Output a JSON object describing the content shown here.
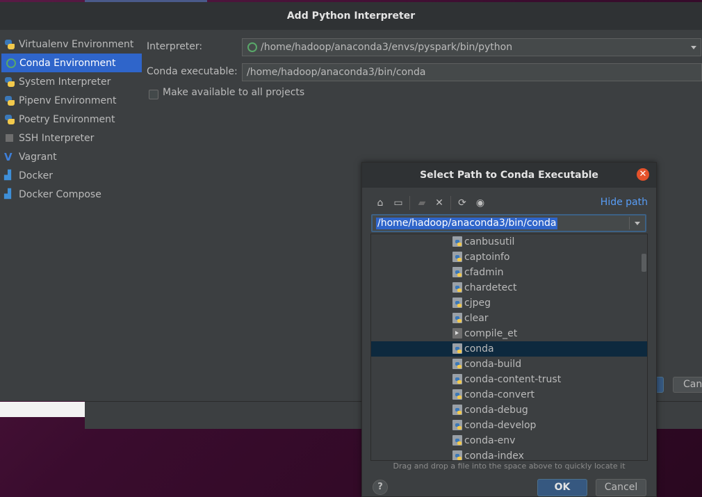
{
  "main_dialog": {
    "title": "Add Python Interpreter",
    "sidebar": [
      {
        "label": "Virtualenv Environment",
        "icon": "python-icon"
      },
      {
        "label": "Conda Environment",
        "icon": "conda-icon",
        "selected": true
      },
      {
        "label": "System Interpreter",
        "icon": "python-icon"
      },
      {
        "label": "Pipenv Environment",
        "icon": "pipenv-icon"
      },
      {
        "label": "Poetry Environment",
        "icon": "poetry-icon"
      },
      {
        "label": "SSH Interpreter",
        "icon": "terminal-icon"
      },
      {
        "label": "Vagrant",
        "icon": "vagrant-icon"
      },
      {
        "label": "Docker",
        "icon": "docker-icon"
      },
      {
        "label": "Docker Compose",
        "icon": "docker-icon"
      }
    ],
    "interpreter_label": "Interpreter:",
    "interpreter_value": "/home/hadoop/anaconda3/envs/pyspark/bin/python",
    "conda_exec_label": "Conda executable:",
    "conda_exec_value": "/home/hadoop/anaconda3/bin/conda",
    "make_available_label": "Make available to all projects",
    "cancel_peek": "Canc"
  },
  "file_chooser": {
    "title": "Select Path to Conda Executable",
    "hide_path": "Hide path",
    "path_value": "/home/hadoop/anaconda3/bin/conda",
    "files": [
      {
        "name": "canbusutil",
        "icon": "python-file-icon"
      },
      {
        "name": "captoinfo",
        "icon": "python-file-icon"
      },
      {
        "name": "cfadmin",
        "icon": "python-file-icon"
      },
      {
        "name": "chardetect",
        "icon": "python-file-icon"
      },
      {
        "name": "cjpeg",
        "icon": "python-file-icon"
      },
      {
        "name": "clear",
        "icon": "python-file-icon"
      },
      {
        "name": "compile_et",
        "icon": "executable-icon"
      },
      {
        "name": "conda",
        "icon": "python-file-icon",
        "selected": true
      },
      {
        "name": "conda-build",
        "icon": "python-file-icon"
      },
      {
        "name": "conda-content-trust",
        "icon": "python-file-icon"
      },
      {
        "name": "conda-convert",
        "icon": "python-file-icon"
      },
      {
        "name": "conda-debug",
        "icon": "python-file-icon"
      },
      {
        "name": "conda-develop",
        "icon": "python-file-icon"
      },
      {
        "name": "conda-env",
        "icon": "python-file-icon"
      },
      {
        "name": "conda-index",
        "icon": "python-file-icon"
      }
    ],
    "hint": "Drag and drop a file into the space above to quickly locate it",
    "help": "?",
    "ok": "OK",
    "cancel": "Cancel"
  },
  "colors": {
    "accent": "#2f65ca",
    "selected_row": "#0d293e",
    "link": "#589df6",
    "close": "#e5522b"
  }
}
